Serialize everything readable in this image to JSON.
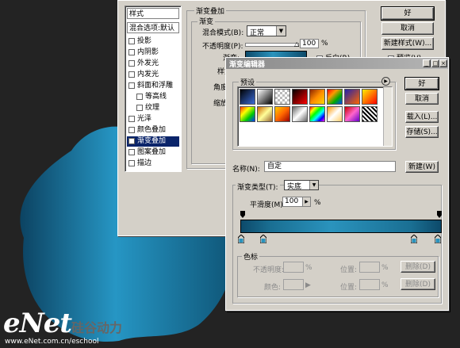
{
  "watermark": {
    "logo_left": "eNet",
    "logo_right": "硅谷动力",
    "url": "www.eNet.com.cn/eschool"
  },
  "layer_style": {
    "styles_header": "样式",
    "blend_defaults": "混合选项:默认",
    "effects": [
      {
        "label": "投影",
        "checked": false
      },
      {
        "label": "内阴影",
        "checked": false
      },
      {
        "label": "外发光",
        "checked": false
      },
      {
        "label": "内发光",
        "checked": false
      },
      {
        "label": "斜面和浮雕",
        "checked": false
      },
      {
        "label": "等高线",
        "checked": false,
        "sub": true
      },
      {
        "label": "纹理",
        "checked": false,
        "sub": true
      },
      {
        "label": "光泽",
        "checked": false
      },
      {
        "label": "颜色叠加",
        "checked": false
      },
      {
        "label": "渐变叠加",
        "checked": true,
        "selected": true
      },
      {
        "label": "图案叠加",
        "checked": false
      },
      {
        "label": "描边",
        "checked": false
      }
    ],
    "group_title": "渐变叠加",
    "sub_group_title": "渐变",
    "blend_mode_label": "混合模式(B):",
    "blend_mode_value": "正常",
    "opacity_label": "不透明度(P):",
    "opacity_value": "100",
    "opacity_unit": "%",
    "gradient_label": "渐变:",
    "reverse_label": "反向(R)",
    "style_label": "样式",
    "angle_label": "角度",
    "scale_label": "缩放",
    "ok": "好",
    "cancel": "取消",
    "new_style": "新建样式(W)...",
    "preview": "预览(V)"
  },
  "gradient_editor": {
    "title": "渐变编辑器",
    "presets_label": "预设",
    "ok": "好",
    "cancel": "取消",
    "load": "载入(L)...",
    "save": "存储(S)...",
    "name_label": "名称(N):",
    "name_value": "自定",
    "new_button": "新建(W)",
    "type_label": "渐变类型(T):",
    "type_value": "实底",
    "smooth_label": "平滑度(M):",
    "smooth_value": "100",
    "smooth_unit": "%",
    "stops_title": "色标",
    "stop_opacity_label": "不透明度:",
    "stop_color_label": "颜色:",
    "location_label": "位置:",
    "delete_label": "删除(D)",
    "pct": "%"
  },
  "colors": {
    "gradient_dark": "#0d4a6a",
    "gradient_light": "#2a93bd",
    "title_bar": "#0a246a"
  }
}
